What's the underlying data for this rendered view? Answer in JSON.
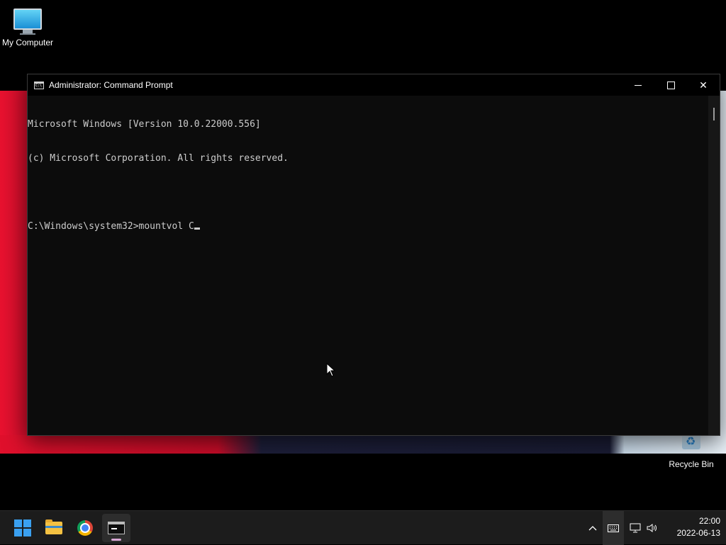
{
  "desktop": {
    "icons": [
      {
        "label": "My Computer"
      },
      {
        "label": "Recycle Bin"
      }
    ]
  },
  "window": {
    "title": "Administrator: Command Prompt",
    "console_lines": [
      "Microsoft Windows [Version 10.0.22000.556]",
      "(c) Microsoft Corporation. All rights reserved.",
      "",
      "C:\\Windows\\system32>mountvol C"
    ],
    "controls": {
      "minimize_icon": "minimize-icon",
      "maximize_icon": "maximize-icon",
      "close_icon": "close-icon",
      "close_glyph": "✕"
    }
  },
  "taskbar": {
    "apps": [
      {
        "name": "Start",
        "icon": "windows-start-icon"
      },
      {
        "name": "File Explorer",
        "icon": "folder-icon"
      },
      {
        "name": "Google Chrome",
        "icon": "chrome-icon"
      },
      {
        "name": "Command Prompt",
        "icon": "cmd-icon",
        "active": true
      }
    ],
    "tray": {
      "chevron_glyph": "^",
      "volume_glyph": "🔊"
    },
    "clock": {
      "time": "22:00",
      "date": "2022-06-13"
    }
  },
  "colors": {
    "console_bg": "#0c0c0c",
    "console_text": "#cccccc",
    "taskbar_bg": "#1c1c1c",
    "start_accent": "#3aa0f0"
  }
}
